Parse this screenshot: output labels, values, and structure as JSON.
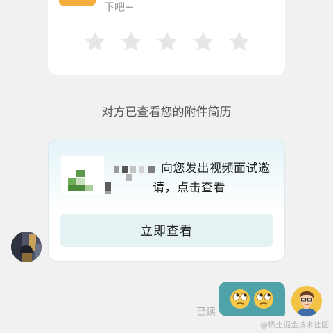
{
  "rating_card": {
    "cut_text": "下吧~",
    "stars": [
      "star",
      "star",
      "star",
      "star",
      "star"
    ],
    "star_color": "#e8e8e8",
    "button_color": "#f5ae3b"
  },
  "system_note": "对方已查看您的附件简历",
  "invite_card": {
    "line1": "向您发出视频面试邀",
    "line2": "请，点击查看",
    "button_label": "立即查看"
  },
  "own_message": {
    "read_status": "已读",
    "emojis": [
      "rolling-eyes-emoji",
      "rolling-eyes-emoji"
    ],
    "bubble_color": "#4fa3a8"
  },
  "watermark": "@稀土掘金技术社区"
}
